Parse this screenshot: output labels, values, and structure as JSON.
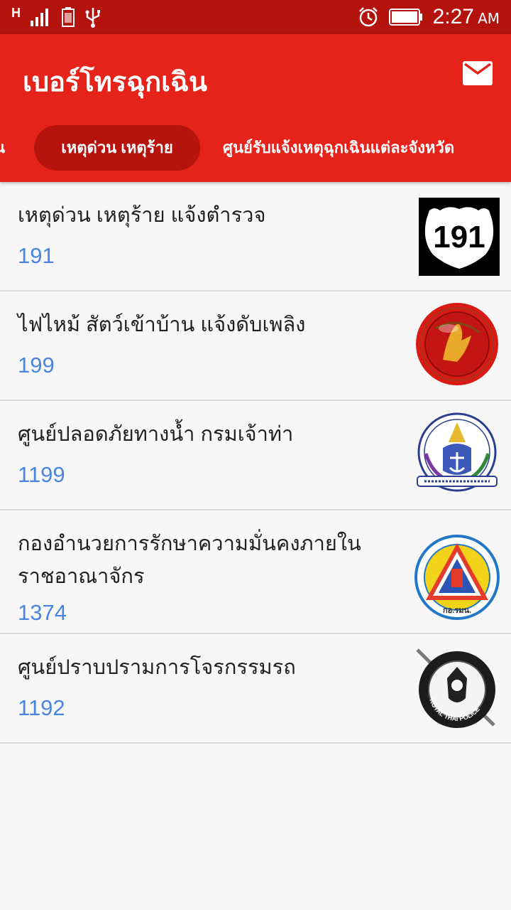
{
  "status_bar": {
    "network": "H",
    "time": "2:27",
    "ampm": "AM",
    "battery_level_percent": 100
  },
  "app": {
    "title": "เบอร์โทรฉุกเฉิน",
    "accent_color": "#e5231a",
    "dark_color": "#b3130c",
    "number_color": "#4a86e0"
  },
  "tabs": [
    {
      "label": "น"
    },
    {
      "label": "เหตุด่วน เหตุร้าย",
      "selected": true
    },
    {
      "label": "ศูนย์รับแจ้งเหตุฉุกเฉินแต่ละจังหวัด"
    }
  ],
  "items": [
    {
      "title": "เหตุด่วน เหตุร้าย แจ้งตำรวจ",
      "number": "191",
      "logo_label": "191",
      "icon": "highway-shield-191-icon"
    },
    {
      "title": "ไฟไหม้ สัตว์เข้าบ้าน แจ้งดับเพลิง",
      "number": "199",
      "icon": "fire-department-emblem-icon"
    },
    {
      "title": "ศูนย์ปลอดภัยทางน้ำ กรมเจ้าท่า",
      "number": "1199",
      "icon": "marine-department-emblem-icon"
    },
    {
      "title": "กองอำนวยการรักษาความมั่นคงภายในราชอาณาจักร",
      "number": "1374",
      "icon": "isoc-emblem-icon",
      "logo_label": "กอ.รมน."
    },
    {
      "title": "ศูนย์ปราบปรามการโจรกรรมรถ",
      "number": "1192",
      "icon": "royal-thai-police-emblem-icon",
      "logo_label": "ROYAL THAI POLICE"
    }
  ]
}
